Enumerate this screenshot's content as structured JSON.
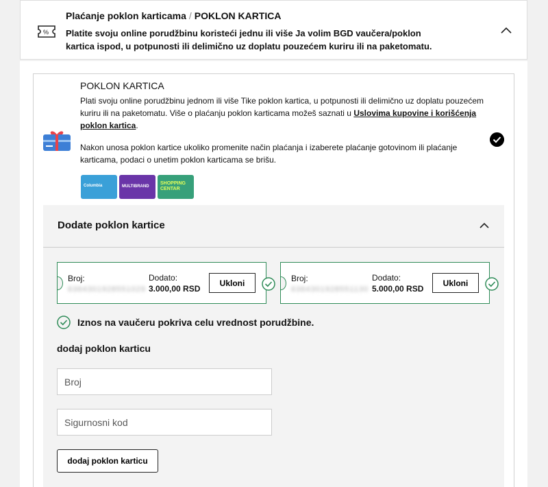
{
  "header": {
    "title": "Plaćanje poklon karticama",
    "separator": "/",
    "subtitle": "POKLON KARTICA",
    "description_prefix": "Platite svoju online porudžbinu koristeći jednu ili više ",
    "description_brand": "Ja volim BGD vaučera",
    "description_suffix": "/poklon kartica ispod, u potpunosti ili delimično uz doplatu pouzećem kuriru ili na paketomatu."
  },
  "payment_option": {
    "title": "POKLON KARTICA",
    "text": "Plati svoju online porudžbinu jednom ili više Tike poklon kartica, u potpunosti ili delimično uz doplatu pouzećem kuriru ili na paketomatu. Više o plaćanju poklon karticama možeš saznati u ",
    "link": "Uslovima kupovine i korišćenja poklon kartica",
    "text_end": ".",
    "note": "Nakon unosa poklon kartice ukoliko promenite način plaćanja i izaberete plaćanje gotovinom ili plaćanje karticama, podaci o unetim poklon karticama se brišu.",
    "card_images": [
      {
        "label": "Columbia",
        "color": "#3aa0d8"
      },
      {
        "label": "MULTIBRAND",
        "color": "#6a35a8"
      },
      {
        "label": "SHOPPING CENTAR",
        "color": "#37a07a"
      }
    ]
  },
  "added_section": {
    "title": "Dodate poklon kartice",
    "cards": [
      {
        "number_label": "Broj:",
        "number": "6364301928551029",
        "added_label": "Dodato:",
        "amount": "3.000,00 RSD",
        "remove_label": "Ukloni"
      },
      {
        "number_label": "Broj:",
        "number": "6364301928551130",
        "added_label": "Dodato:",
        "amount": "5.000,00 RSD",
        "remove_label": "Ukloni"
      }
    ],
    "coverage_message": "Iznos na vaučeru pokriva celu vrednost porudžbine."
  },
  "add_form": {
    "title": "dodaj poklon karticu",
    "number_placeholder": "Broj",
    "code_placeholder": "Sigurnosni kod",
    "submit_label": "dodaj poklon karticu"
  },
  "colors": {
    "success": "#2e8b57",
    "panel": "#f3f3f3"
  }
}
